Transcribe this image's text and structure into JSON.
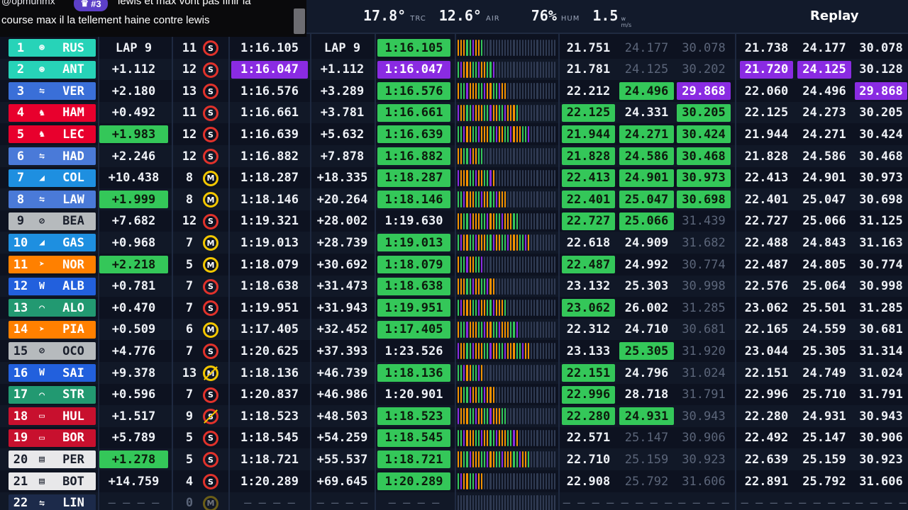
{
  "chat": {
    "user": "@opmunmx",
    "badge": "#3",
    "line1": "lewis et max vont pas finir la",
    "line2": "course max il la tellement haine contre lewis"
  },
  "weather": {
    "track": "17.8°",
    "track_label": "TRC",
    "air": "12.6°",
    "air_label": "AIR",
    "hum": "76%",
    "hum_label": "HUM",
    "wind": "1.5",
    "wind_unit_top": "w",
    "wind_unit_bot": "m/s"
  },
  "replay_label": "Replay",
  "colors": {
    "green": "#34c759",
    "purple": "#8a2be2",
    "soft": "#e1322b",
    "medium": "#f3c700"
  },
  "drivers": [
    {
      "pos": "1",
      "code": "RUS",
      "team_color": "#27d3b8",
      "logo": "mercedes-icon",
      "gap": "LAP 9",
      "gap_hl": "",
      "laps": "11",
      "tyre": "S",
      "tyre_new": false,
      "best": "1:16.105",
      "best_hl": "",
      "int": "LAP 9",
      "last": "1:16.105",
      "last_hl": "g",
      "s1": "21.751",
      "s1_hl": "",
      "s2": "24.177",
      "s2_hl": "d",
      "s3": "30.078",
      "s3_hl": "d",
      "b1": "21.738",
      "b1_hl": "",
      "b2": "24.177",
      "b2_hl": "",
      "b3": "30.078",
      "b3_hl": ""
    },
    {
      "pos": "2",
      "code": "ANT",
      "team_color": "#27d3b8",
      "logo": "mercedes-icon",
      "gap": "+1.112",
      "gap_hl": "",
      "laps": "12",
      "tyre": "S",
      "tyre_new": false,
      "best": "1:16.047",
      "best_hl": "p",
      "int": "+1.112",
      "last": "1:16.047",
      "last_hl": "p",
      "s1": "21.781",
      "s1_hl": "",
      "s2": "24.125",
      "s2_hl": "d",
      "s3": "30.202",
      "s3_hl": "d",
      "b1": "21.720",
      "b1_hl": "p",
      "b2": "24.125",
      "b2_hl": "p",
      "b3": "30.128",
      "b3_hl": ""
    },
    {
      "pos": "3",
      "code": "VER",
      "team_color": "#3a6fd8",
      "logo": "redbull-icon",
      "gap": "+2.180",
      "gap_hl": "",
      "laps": "13",
      "tyre": "S",
      "tyre_new": false,
      "best": "1:16.576",
      "best_hl": "",
      "int": "+3.289",
      "last": "1:16.576",
      "last_hl": "g",
      "s1": "22.212",
      "s1_hl": "",
      "s2": "24.496",
      "s2_hl": "g",
      "s3": "29.868",
      "s3_hl": "p",
      "b1": "22.060",
      "b1_hl": "",
      "b2": "24.496",
      "b2_hl": "",
      "b3": "29.868",
      "b3_hl": "p"
    },
    {
      "pos": "4",
      "code": "HAM",
      "team_color": "#e8002d",
      "logo": "ferrari-icon",
      "gap": "+0.492",
      "gap_hl": "",
      "laps": "11",
      "tyre": "S",
      "tyre_new": false,
      "best": "1:16.661",
      "best_hl": "",
      "int": "+3.781",
      "last": "1:16.661",
      "last_hl": "g",
      "s1": "22.125",
      "s1_hl": "g",
      "s2": "24.331",
      "s2_hl": "",
      "s3": "30.205",
      "s3_hl": "g",
      "b1": "22.125",
      "b1_hl": "",
      "b2": "24.273",
      "b2_hl": "",
      "b3": "30.205",
      "b3_hl": ""
    },
    {
      "pos": "5",
      "code": "LEC",
      "team_color": "#e8002d",
      "logo": "ferrari-icon",
      "gap": "+1.983",
      "gap_hl": "g",
      "laps": "12",
      "tyre": "S",
      "tyre_new": false,
      "best": "1:16.639",
      "best_hl": "",
      "int": "+5.632",
      "last": "1:16.639",
      "last_hl": "g",
      "s1": "21.944",
      "s1_hl": "g",
      "s2": "24.271",
      "s2_hl": "g",
      "s3": "30.424",
      "s3_hl": "g",
      "b1": "21.944",
      "b1_hl": "",
      "b2": "24.271",
      "b2_hl": "",
      "b3": "30.424",
      "b3_hl": ""
    },
    {
      "pos": "6",
      "code": "HAD",
      "team_color": "#4a7ad8",
      "logo": "rb-icon",
      "gap": "+2.246",
      "gap_hl": "",
      "laps": "12",
      "tyre": "S",
      "tyre_new": false,
      "best": "1:16.882",
      "best_hl": "",
      "int": "+7.878",
      "last": "1:16.882",
      "last_hl": "g",
      "s1": "21.828",
      "s1_hl": "g",
      "s2": "24.586",
      "s2_hl": "g",
      "s3": "30.468",
      "s3_hl": "g",
      "b1": "21.828",
      "b1_hl": "",
      "b2": "24.586",
      "b2_hl": "",
      "b3": "30.468",
      "b3_hl": ""
    },
    {
      "pos": "7",
      "code": "COL",
      "team_color": "#1e8fe0",
      "logo": "alpine-icon",
      "gap": "+10.438",
      "gap_hl": "",
      "laps": "8",
      "tyre": "M",
      "tyre_new": false,
      "best": "1:18.287",
      "best_hl": "",
      "int": "+18.335",
      "last": "1:18.287",
      "last_hl": "g",
      "s1": "22.413",
      "s1_hl": "g",
      "s2": "24.901",
      "s2_hl": "g",
      "s3": "30.973",
      "s3_hl": "g",
      "b1": "22.413",
      "b1_hl": "",
      "b2": "24.901",
      "b2_hl": "",
      "b3": "30.973",
      "b3_hl": ""
    },
    {
      "pos": "8",
      "code": "LAW",
      "team_color": "#4a7ad8",
      "logo": "rb-icon",
      "gap": "+1.999",
      "gap_hl": "g",
      "laps": "8",
      "tyre": "M",
      "tyre_new": false,
      "best": "1:18.146",
      "best_hl": "",
      "int": "+20.264",
      "last": "1:18.146",
      "last_hl": "g",
      "s1": "22.401",
      "s1_hl": "g",
      "s2": "25.047",
      "s2_hl": "g",
      "s3": "30.698",
      "s3_hl": "g",
      "b1": "22.401",
      "b1_hl": "",
      "b2": "25.047",
      "b2_hl": "",
      "b3": "30.698",
      "b3_hl": ""
    },
    {
      "pos": "9",
      "code": "BEA",
      "team_color": "#b6babd",
      "logo": "haas-icon",
      "gap": "+7.682",
      "gap_hl": "",
      "laps": "12",
      "tyre": "S",
      "tyre_new": false,
      "best": "1:19.321",
      "best_hl": "",
      "int": "+28.002",
      "last": "1:19.630",
      "last_hl": "",
      "s1": "22.727",
      "s1_hl": "g",
      "s2": "25.066",
      "s2_hl": "g",
      "s3": "31.439",
      "s3_hl": "d",
      "b1": "22.727",
      "b1_hl": "",
      "b2": "25.066",
      "b2_hl": "",
      "b3": "31.125",
      "b3_hl": ""
    },
    {
      "pos": "10",
      "code": "GAS",
      "team_color": "#1e8fe0",
      "logo": "alpine-icon",
      "gap": "+0.968",
      "gap_hl": "",
      "laps": "7",
      "tyre": "M",
      "tyre_new": false,
      "best": "1:19.013",
      "best_hl": "",
      "int": "+28.739",
      "last": "1:19.013",
      "last_hl": "g",
      "s1": "22.618",
      "s1_hl": "",
      "s2": "24.909",
      "s2_hl": "",
      "s3": "31.682",
      "s3_hl": "d",
      "b1": "22.488",
      "b1_hl": "",
      "b2": "24.843",
      "b2_hl": "",
      "b3": "31.163",
      "b3_hl": ""
    },
    {
      "pos": "11",
      "code": "NOR",
      "team_color": "#ff8000",
      "logo": "mclaren-icon",
      "gap": "+2.218",
      "gap_hl": "g",
      "laps": "5",
      "tyre": "M",
      "tyre_new": false,
      "best": "1:18.079",
      "best_hl": "",
      "int": "+30.692",
      "last": "1:18.079",
      "last_hl": "g",
      "s1": "22.487",
      "s1_hl": "g",
      "s2": "24.992",
      "s2_hl": "",
      "s3": "30.774",
      "s3_hl": "d",
      "b1": "22.487",
      "b1_hl": "",
      "b2": "24.805",
      "b2_hl": "",
      "b3": "30.774",
      "b3_hl": ""
    },
    {
      "pos": "12",
      "code": "ALB",
      "team_color": "#2260dd",
      "logo": "williams-icon",
      "gap": "+0.781",
      "gap_hl": "",
      "laps": "7",
      "tyre": "S",
      "tyre_new": false,
      "best": "1:18.638",
      "best_hl": "",
      "int": "+31.473",
      "last": "1:18.638",
      "last_hl": "g",
      "s1": "23.132",
      "s1_hl": "",
      "s2": "25.303",
      "s2_hl": "",
      "s3": "30.998",
      "s3_hl": "d",
      "b1": "22.576",
      "b1_hl": "",
      "b2": "25.064",
      "b2_hl": "",
      "b3": "30.998",
      "b3_hl": ""
    },
    {
      "pos": "13",
      "code": "ALO",
      "team_color": "#229971",
      "logo": "aston-icon",
      "gap": "+0.470",
      "gap_hl": "",
      "laps": "7",
      "tyre": "S",
      "tyre_new": false,
      "best": "1:19.951",
      "best_hl": "",
      "int": "+31.943",
      "last": "1:19.951",
      "last_hl": "g",
      "s1": "23.062",
      "s1_hl": "g",
      "s2": "26.002",
      "s2_hl": "",
      "s3": "31.285",
      "s3_hl": "d",
      "b1": "23.062",
      "b1_hl": "",
      "b2": "25.501",
      "b2_hl": "",
      "b3": "31.285",
      "b3_hl": ""
    },
    {
      "pos": "14",
      "code": "PIA",
      "team_color": "#ff8000",
      "logo": "mclaren-icon",
      "gap": "+0.509",
      "gap_hl": "",
      "laps": "6",
      "tyre": "M",
      "tyre_new": false,
      "best": "1:17.405",
      "best_hl": "",
      "int": "+32.452",
      "last": "1:17.405",
      "last_hl": "g",
      "s1": "22.312",
      "s1_hl": "",
      "s2": "24.710",
      "s2_hl": "",
      "s3": "30.681",
      "s3_hl": "d",
      "b1": "22.165",
      "b1_hl": "",
      "b2": "24.559",
      "b2_hl": "",
      "b3": "30.681",
      "b3_hl": ""
    },
    {
      "pos": "15",
      "code": "OCO",
      "team_color": "#b6babd",
      "logo": "haas-icon",
      "gap": "+4.776",
      "gap_hl": "",
      "laps": "7",
      "tyre": "S",
      "tyre_new": false,
      "best": "1:20.625",
      "best_hl": "",
      "int": "+37.393",
      "last": "1:23.526",
      "last_hl": "",
      "s1": "23.133",
      "s1_hl": "",
      "s2": "25.305",
      "s2_hl": "g",
      "s3": "31.920",
      "s3_hl": "d",
      "b1": "23.044",
      "b1_hl": "",
      "b2": "25.305",
      "b2_hl": "",
      "b3": "31.314",
      "b3_hl": ""
    },
    {
      "pos": "16",
      "code": "SAI",
      "team_color": "#2260dd",
      "logo": "williams-icon",
      "gap": "+9.378",
      "gap_hl": "",
      "laps": "13",
      "tyre": "M",
      "tyre_new": true,
      "best": "1:18.136",
      "best_hl": "",
      "int": "+46.739",
      "last": "1:18.136",
      "last_hl": "g",
      "s1": "22.151",
      "s1_hl": "g",
      "s2": "24.796",
      "s2_hl": "",
      "s3": "31.024",
      "s3_hl": "d",
      "b1": "22.151",
      "b1_hl": "",
      "b2": "24.749",
      "b2_hl": "",
      "b3": "31.024",
      "b3_hl": ""
    },
    {
      "pos": "17",
      "code": "STR",
      "team_color": "#229971",
      "logo": "aston-icon",
      "gap": "+0.596",
      "gap_hl": "",
      "laps": "7",
      "tyre": "S",
      "tyre_new": false,
      "best": "1:20.837",
      "best_hl": "",
      "int": "+46.986",
      "last": "1:20.901",
      "last_hl": "",
      "s1": "22.996",
      "s1_hl": "g",
      "s2": "28.718",
      "s2_hl": "",
      "s3": "31.791",
      "s3_hl": "d",
      "b1": "22.996",
      "b1_hl": "",
      "b2": "25.710",
      "b2_hl": "",
      "b3": "31.791",
      "b3_hl": ""
    },
    {
      "pos": "18",
      "code": "HUL",
      "team_color": "#c8102e",
      "logo": "sauber-icon",
      "gap": "+1.517",
      "gap_hl": "",
      "laps": "9",
      "tyre": "S",
      "tyre_new": true,
      "best": "1:18.523",
      "best_hl": "",
      "int": "+48.503",
      "last": "1:18.523",
      "last_hl": "g",
      "s1": "22.280",
      "s1_hl": "g",
      "s2": "24.931",
      "s2_hl": "g",
      "s3": "30.943",
      "s3_hl": "d",
      "b1": "22.280",
      "b1_hl": "",
      "b2": "24.931",
      "b2_hl": "",
      "b3": "30.943",
      "b3_hl": ""
    },
    {
      "pos": "19",
      "code": "BOR",
      "team_color": "#c8102e",
      "logo": "sauber-icon",
      "gap": "+5.789",
      "gap_hl": "",
      "laps": "5",
      "tyre": "S",
      "tyre_new": false,
      "best": "1:18.545",
      "best_hl": "",
      "int": "+54.259",
      "last": "1:18.545",
      "last_hl": "g",
      "s1": "22.571",
      "s1_hl": "",
      "s2": "25.147",
      "s2_hl": "d",
      "s3": "30.906",
      "s3_hl": "d",
      "b1": "22.492",
      "b1_hl": "",
      "b2": "25.147",
      "b2_hl": "",
      "b3": "30.906",
      "b3_hl": ""
    },
    {
      "pos": "20",
      "code": "PER",
      "team_color": "#e8e8ea",
      "logo": "cadillac-icon",
      "gap": "+1.278",
      "gap_hl": "g",
      "laps": "5",
      "tyre": "S",
      "tyre_new": false,
      "best": "1:18.721",
      "best_hl": "",
      "int": "+55.537",
      "last": "1:18.721",
      "last_hl": "g",
      "s1": "22.710",
      "s1_hl": "",
      "s2": "25.159",
      "s2_hl": "d",
      "s3": "30.923",
      "s3_hl": "d",
      "b1": "22.639",
      "b1_hl": "",
      "b2": "25.159",
      "b2_hl": "",
      "b3": "30.923",
      "b3_hl": ""
    },
    {
      "pos": "21",
      "code": "BOT",
      "team_color": "#e8e8ea",
      "logo": "cadillac-icon",
      "gap": "+14.759",
      "gap_hl": "",
      "laps": "4",
      "tyre": "S",
      "tyre_new": false,
      "best": "1:20.289",
      "best_hl": "",
      "int": "+69.645",
      "last": "1:20.289",
      "last_hl": "g",
      "s1": "22.908",
      "s1_hl": "",
      "s2": "25.792",
      "s2_hl": "d",
      "s3": "31.606",
      "s3_hl": "d",
      "b1": "22.891",
      "b1_hl": "",
      "b2": "25.792",
      "b2_hl": "",
      "b3": "31.606",
      "b3_hl": ""
    },
    {
      "pos": "22",
      "code": "LIN",
      "team_color": "#1c2a4a",
      "logo": "rb-icon",
      "gap": "",
      "gap_hl": "",
      "laps": "0",
      "tyre": "M",
      "tyre_new": false,
      "best": "",
      "best_hl": "",
      "int": "",
      "last": "",
      "last_hl": "",
      "s1": "",
      "s1_hl": "",
      "s2": "",
      "s2_hl": "",
      "s3": "",
      "s3_hl": "",
      "b1": "",
      "b1_hl": "",
      "b2": "",
      "b2_hl": "",
      "b3": "",
      "b3_hl": ""
    }
  ]
}
